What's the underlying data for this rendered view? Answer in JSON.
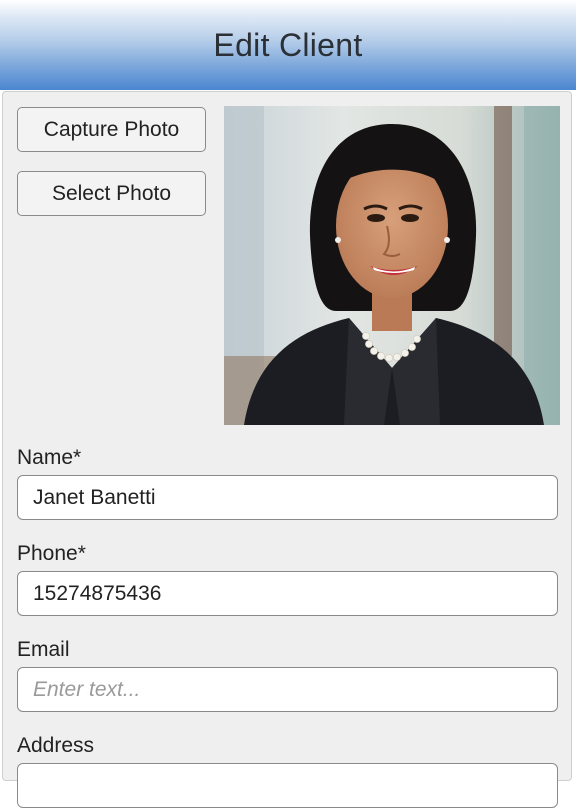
{
  "header": {
    "title": "Edit Client"
  },
  "photo_actions": {
    "capture_label": "Capture Photo",
    "select_label": "Select Photo"
  },
  "form": {
    "name": {
      "label": "Name*",
      "value": "Janet Banetti"
    },
    "phone": {
      "label": "Phone*",
      "value": "15274875436"
    },
    "email": {
      "label": "Email",
      "value": "",
      "placeholder": "Enter text..."
    },
    "address": {
      "label": "Address",
      "value": ""
    }
  }
}
